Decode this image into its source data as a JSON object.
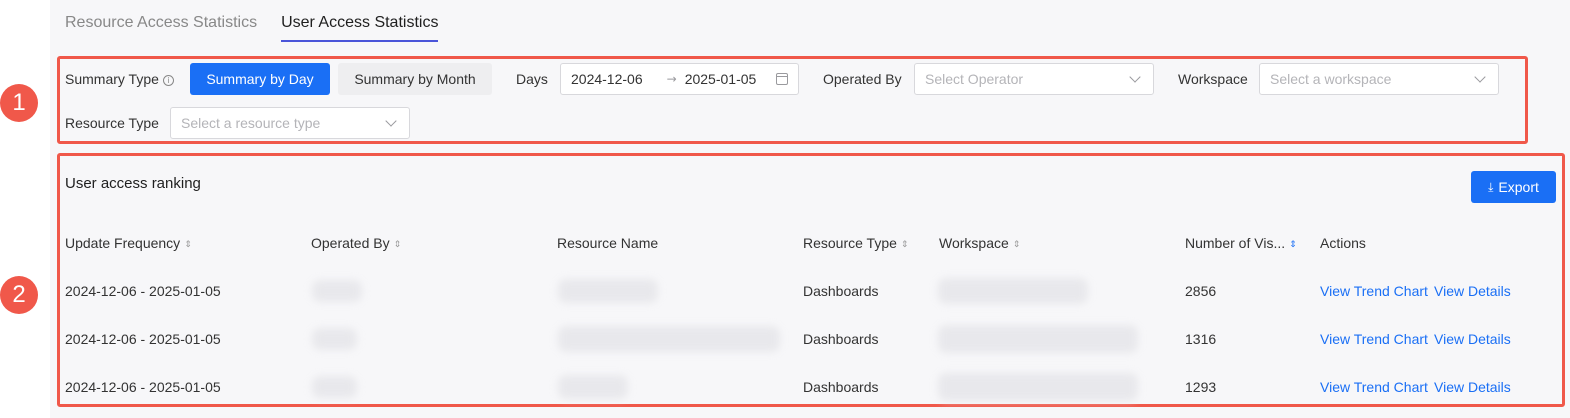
{
  "tabs": [
    {
      "label": "Resource Access Statistics",
      "active": false
    },
    {
      "label": "User Access Statistics",
      "active": true
    }
  ],
  "annotations": [
    "1",
    "2"
  ],
  "filters": {
    "summary_type_label": "Summary Type",
    "summary_type_info_icon": "info-icon",
    "summary_by_day": "Summary by Day",
    "summary_by_month": "Summary by Month",
    "days_label": "Days",
    "date_start": "2024-12-06",
    "date_end": "2025-01-05",
    "operated_by_label": "Operated By",
    "operator_placeholder": "Select Operator",
    "workspace_label": "Workspace",
    "workspace_placeholder": "Select a workspace",
    "resource_type_label": "Resource Type",
    "resource_type_placeholder": "Select a resource type"
  },
  "section": {
    "title": "User access ranking",
    "export_label": "Export"
  },
  "table": {
    "headers": {
      "update_frequency": "Update Frequency",
      "operated_by": "Operated By",
      "resource_name": "Resource Name",
      "resource_type": "Resource Type",
      "workspace": "Workspace",
      "visits": "Number of Vis...",
      "actions": "Actions"
    },
    "rows": [
      {
        "update_frequency": "2024-12-06 - 2025-01-05",
        "resource_type": "Dashboards",
        "visits": "2856",
        "trend_link": "View Trend Chart",
        "details_link": "View Details"
      },
      {
        "update_frequency": "2024-12-06 - 2025-01-05",
        "resource_type": "Dashboards",
        "visits": "1316",
        "trend_link": "View Trend Chart",
        "details_link": "View Details"
      },
      {
        "update_frequency": "2024-12-06 - 2025-01-05",
        "resource_type": "Dashboards",
        "visits": "1293",
        "trend_link": "View Trend Chart",
        "details_link": "View Details"
      }
    ]
  },
  "colors": {
    "primary": "#1a6ff5",
    "annotation": "#f0584a",
    "tab_underline": "#4a55d9"
  }
}
